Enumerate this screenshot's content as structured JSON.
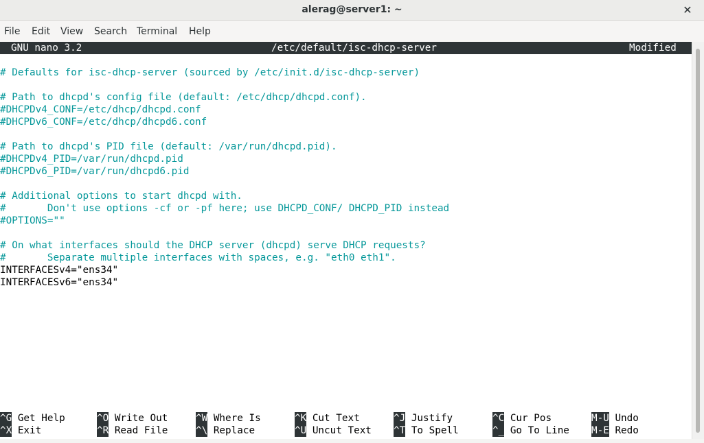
{
  "window": {
    "title": "alerag@server1: ~",
    "close_icon": "✕"
  },
  "menubar": {
    "items": [
      "File",
      "Edit",
      "View",
      "Search",
      "Terminal",
      "Help"
    ]
  },
  "nano": {
    "version": "GNU nano 3.2",
    "filename": "/etc/default/isc-dhcp-server",
    "status": "Modified"
  },
  "file_lines": [
    {
      "text": "",
      "type": "plain"
    },
    {
      "text": "# Defaults for isc-dhcp-server (sourced by /etc/init.d/isc-dhcp-server)",
      "type": "comment"
    },
    {
      "text": "",
      "type": "plain"
    },
    {
      "text": "# Path to dhcpd's config file (default: /etc/dhcp/dhcpd.conf).",
      "type": "comment"
    },
    {
      "text": "#DHCPDv4_CONF=/etc/dhcp/dhcpd.conf",
      "type": "comment"
    },
    {
      "text": "#DHCPDv6_CONF=/etc/dhcp/dhcpd6.conf",
      "type": "comment"
    },
    {
      "text": "",
      "type": "plain"
    },
    {
      "text": "# Path to dhcpd's PID file (default: /var/run/dhcpd.pid).",
      "type": "comment"
    },
    {
      "text": "#DHCPDv4_PID=/var/run/dhcpd.pid",
      "type": "comment"
    },
    {
      "text": "#DHCPDv6_PID=/var/run/dhcpd6.pid",
      "type": "comment"
    },
    {
      "text": "",
      "type": "plain"
    },
    {
      "text": "# Additional options to start dhcpd with.",
      "type": "comment"
    },
    {
      "text": "#       Don't use options -cf or -pf here; use DHCPD_CONF/ DHCPD_PID instead",
      "type": "comment"
    },
    {
      "text": "#OPTIONS=\"\"",
      "type": "comment"
    },
    {
      "text": "",
      "type": "plain"
    },
    {
      "text": "# On what interfaces should the DHCP server (dhcpd) serve DHCP requests?",
      "type": "comment"
    },
    {
      "text": "#       Separate multiple interfaces with spaces, e.g. \"eth0 eth1\".",
      "type": "comment"
    },
    {
      "text": "INTERFACESv4=\"ens34\"",
      "type": "plain"
    },
    {
      "text": "INTERFACESv6=\"ens34\"",
      "type": "plain"
    }
  ],
  "shortcuts": [
    [
      {
        "key": "^G",
        "label": "Get Help"
      },
      {
        "key": "^O",
        "label": "Write Out"
      },
      {
        "key": "^W",
        "label": "Where Is"
      },
      {
        "key": "^K",
        "label": "Cut Text"
      },
      {
        "key": "^J",
        "label": "Justify"
      },
      {
        "key": "^C",
        "label": "Cur Pos"
      },
      {
        "key": "M-U",
        "label": "Undo"
      }
    ],
    [
      {
        "key": "^X",
        "label": "Exit"
      },
      {
        "key": "^R",
        "label": "Read File"
      },
      {
        "key": "^\\",
        "label": "Replace"
      },
      {
        "key": "^U",
        "label": "Uncut Text"
      },
      {
        "key": "^T",
        "label": "To Spell"
      },
      {
        "key": "^_",
        "label": "Go To Line"
      },
      {
        "key": "M-E",
        "label": "Redo"
      }
    ]
  ],
  "colors": {
    "comment": "#06989a",
    "header_bg": "#2e3436",
    "text": "#000000"
  }
}
